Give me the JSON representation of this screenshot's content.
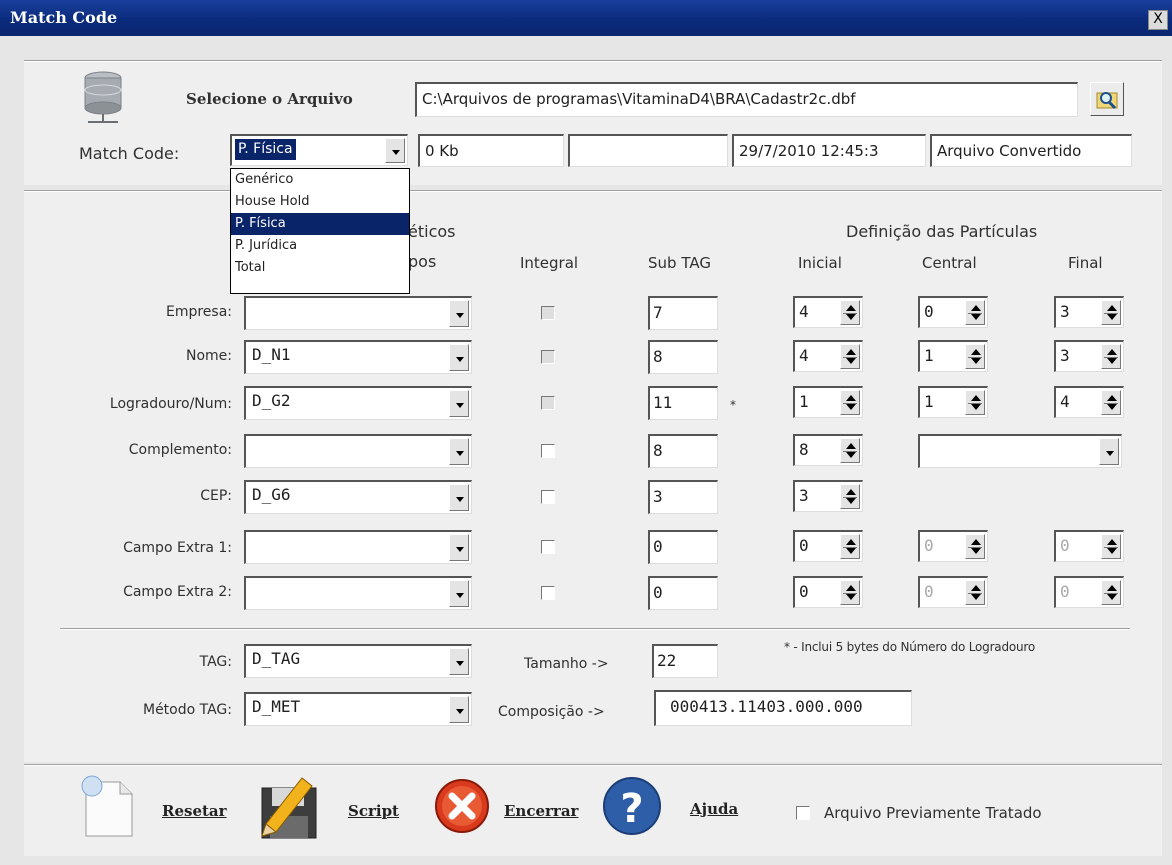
{
  "window": {
    "title": "Match Code",
    "close_label": "X"
  },
  "file": {
    "label": "Selecione o Arquivo",
    "path": "C:\\Arquivos de programas\\VitaminaD4\\BRA\\Cadastr2c.dbf"
  },
  "match": {
    "label": "Match Code:",
    "value": "P. Física",
    "options": [
      "Genérico",
      "House Hold",
      "P. Física",
      "P. Jurídica",
      "Total"
    ],
    "selected_index": 2
  },
  "status": {
    "size": "0 Kb",
    "blank": "",
    "datetime": "29/7/2010 12:45:3",
    "state": "Arquivo Convertido"
  },
  "headers": {
    "fonetic": "éticos",
    "campos": "pos",
    "integral": "Integral",
    "subtag": "Sub TAG",
    "particulas": "Definição das Partículas",
    "inicial": "Inicial",
    "central": "Central",
    "final": "Final"
  },
  "rows": [
    {
      "label": "Empresa:",
      "field": "",
      "integral_enabled": false,
      "subtag": "7",
      "inicial": "4",
      "central": "0",
      "final": "3",
      "note": ""
    },
    {
      "label": "Nome:",
      "field": "D_N1",
      "integral_enabled": false,
      "subtag": "8",
      "inicial": "4",
      "central": "1",
      "final": "3",
      "note": ""
    },
    {
      "label": "Logradouro/Num:",
      "field": "D_G2",
      "integral_enabled": false,
      "subtag": "11",
      "inicial": "1",
      "central": "1",
      "final": "4",
      "note": "*"
    },
    {
      "label": "Complemento:",
      "field": "",
      "integral_enabled": true,
      "subtag": "8",
      "inicial": "8",
      "central": "",
      "final": "",
      "note": ""
    },
    {
      "label": "CEP:",
      "field": "D_G6",
      "integral_enabled": true,
      "subtag": "3",
      "inicial": "3",
      "central": "",
      "final": "",
      "note": ""
    },
    {
      "label": "Campo Extra 1:",
      "field": "",
      "integral_enabled": true,
      "subtag": "0",
      "inicial": "0",
      "central": "0",
      "final": "0",
      "note": ""
    },
    {
      "label": "Campo Extra 2:",
      "field": "",
      "integral_enabled": true,
      "subtag": "0",
      "inicial": "0",
      "central": "0",
      "final": "0",
      "note": ""
    }
  ],
  "tag": {
    "label": "TAG:",
    "value": "D_TAG",
    "size_label": "Tamanho ->",
    "size": "22",
    "note": "* - Inclui 5 bytes do Número do Logradouro"
  },
  "method": {
    "label": "Método TAG:",
    "value": "D_MET",
    "comp_label": "Composição ->",
    "comp": "000413.11403.000.000"
  },
  "buttons": {
    "reset": "Resetar",
    "script": "Script",
    "close": "Encerrar",
    "help": "Ajuda",
    "pretreated": "Arquivo Previamente Tratado"
  },
  "colors": {
    "titlebar": "#0a2a7a",
    "selection": "#0a246a",
    "panel": "#efefef"
  }
}
